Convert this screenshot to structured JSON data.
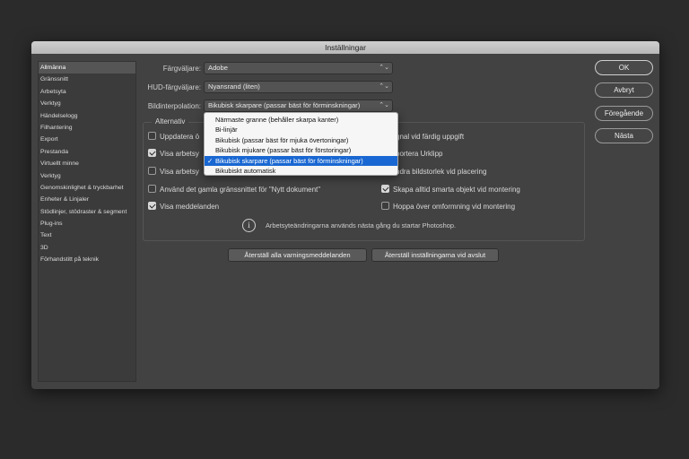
{
  "dialog": {
    "title": "Inställningar"
  },
  "sidebar": {
    "items": [
      {
        "label": "Allmänna",
        "selected": true
      },
      {
        "label": "Gränssnitt"
      },
      {
        "label": "Arbetsyta"
      },
      {
        "label": "Verktyg"
      },
      {
        "label": "Händelselogg"
      },
      {
        "label": "Filhantering"
      },
      {
        "label": "Export"
      },
      {
        "label": "Prestanda"
      },
      {
        "label": "Virtuellt minne"
      },
      {
        "label": "Verktyg"
      },
      {
        "label": "Genomskinlighet & tryckbarhet"
      },
      {
        "label": "Enheter & Linjaler"
      },
      {
        "label": "Stödlinjer, stödraster & segment"
      },
      {
        "label": "Plug-ins"
      },
      {
        "label": "Text"
      },
      {
        "label": "3D"
      },
      {
        "label": "Förhandstitt på teknik"
      }
    ]
  },
  "fields": {
    "color_picker": {
      "label": "Färgväljare:",
      "value": "Adobe"
    },
    "hud_picker": {
      "label": "HUD-färgväljare:",
      "value": "Nyansrand (liten)"
    },
    "interpolation": {
      "label": "Bildinterpolation:",
      "value": "Bikubisk skarpare (passar bäst för förminskningar)"
    }
  },
  "dropdown": {
    "options": [
      {
        "label": "Närmaste granne (behåller skarpa kanter)"
      },
      {
        "label": "Bi-linjär"
      },
      {
        "label": "Bikubisk (passar bäst för mjuka övertoningar)"
      },
      {
        "label": "Bikubisk mjukare (passar bäst för förstoringar)"
      },
      {
        "label": "Bikubisk skarpare (passar bäst för förminskningar)",
        "selected": true,
        "check": "✓"
      },
      {
        "label": "Bikubiskt automatisk"
      }
    ]
  },
  "options": {
    "title": "Alternativ",
    "left": [
      {
        "label": "Uppdatera ö",
        "checked": false
      },
      {
        "label": "Visa arbetsy",
        "checked": true
      },
      {
        "label": "Visa arbetsy",
        "checked": false
      },
      {
        "label": "Använd det gamla gränssnittet för \"Nytt dokument\"",
        "checked": false
      },
      {
        "label": "Visa meddelanden",
        "checked": true
      }
    ],
    "right": [
      {
        "label": "gnal vid färdig uppgift"
      },
      {
        "label": "portera Urklipp"
      },
      {
        "label": "ndra bildstorlek vid placering"
      },
      {
        "label": "Skapa alltid smarta objekt vid montering",
        "checked": true
      },
      {
        "label": "Hoppa över omformning vid montering",
        "checked": false
      }
    ],
    "info_icon": "i",
    "info_text": "Arbetsyteändringarna används nästa gång du startar Photoshop."
  },
  "buttons": {
    "reset_warnings": "Återställ alla varningsmeddelanden",
    "reset_on_quit": "Återställ inställningarna vid avslut",
    "ok": "OK",
    "cancel": "Avbryt",
    "prev": "Föregående",
    "next": "Nästa"
  }
}
